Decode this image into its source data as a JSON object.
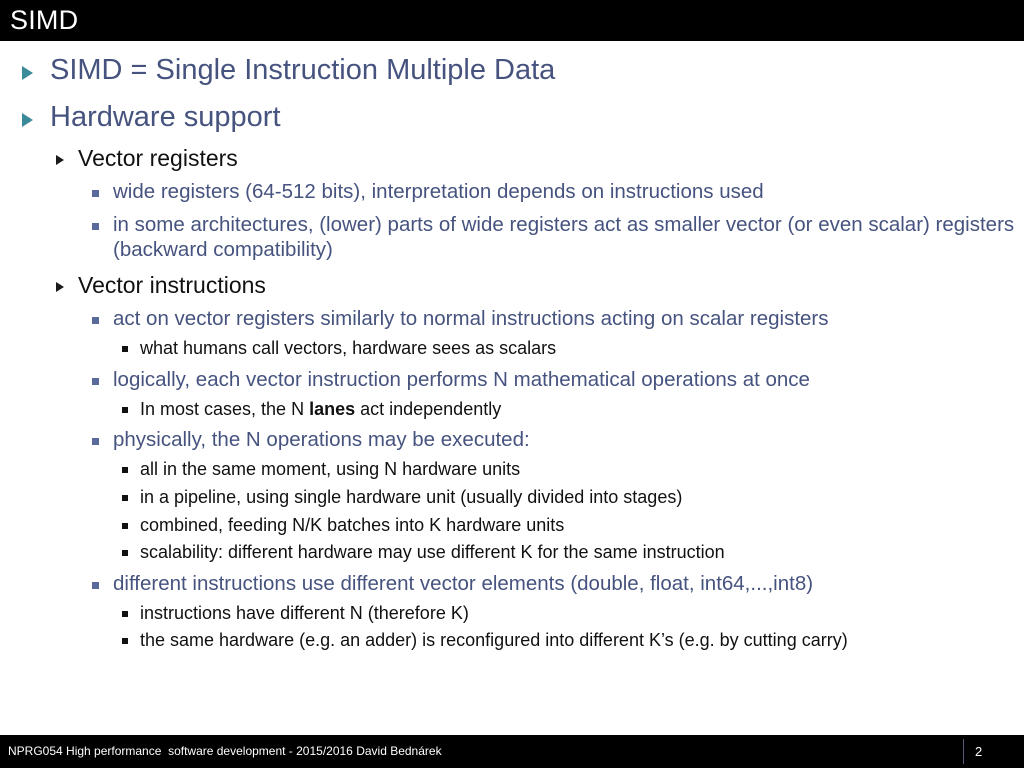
{
  "slide": {
    "title": "SIMD",
    "page_number": "2",
    "colors": {
      "title_bar_bg": "#000000",
      "title_text": "#ffffff",
      "slate_blue_text": "#46537f",
      "black_text": "#111111",
      "level1_marker": "#3b8a99",
      "level3_marker": "#5a6a9a",
      "footer_bg": "#000000",
      "footer_divider": "#5a5a78",
      "page_bg": "#ffffff"
    }
  },
  "bullets": [
    {
      "level": 1,
      "marker": "triangle-right-icon",
      "text": "SIMD = Single Instruction Multiple Data"
    },
    {
      "level": 1,
      "marker": "triangle-right-icon",
      "text": "Hardware support"
    },
    {
      "level": 2,
      "marker": "triangle-right-icon",
      "text": "Vector registers"
    },
    {
      "level": 3,
      "marker": "square-bullet-icon",
      "text": "wide registers (64-512 bits), interpretation depends on instructions used"
    },
    {
      "level": 3,
      "marker": "square-bullet-icon",
      "text": "in some architectures, (lower) parts of wide registers act as smaller vector (or even scalar) registers (backward compatibility)"
    },
    {
      "level": 2,
      "marker": "triangle-right-icon",
      "text": "Vector instructions"
    },
    {
      "level": 3,
      "marker": "square-bullet-icon",
      "text": "act on vector registers similarly to normal instructions acting on scalar registers"
    },
    {
      "level": 4,
      "marker": "square-bullet-icon",
      "text": "what humans call vectors, hardware sees as scalars"
    },
    {
      "level": 3,
      "marker": "square-bullet-icon",
      "text": "logically, each vector instruction performs N mathematical operations at once"
    },
    {
      "level": 4,
      "marker": "square-bullet-icon",
      "html": "In most cases, the N <b>lanes</b> act independently",
      "text": "In most cases, the N lanes act independently"
    },
    {
      "level": 3,
      "marker": "square-bullet-icon",
      "text": "physically, the N operations may be executed:"
    },
    {
      "level": 4,
      "marker": "square-bullet-icon",
      "text": "all in the same moment, using N hardware units"
    },
    {
      "level": 4,
      "marker": "square-bullet-icon",
      "text": "in a pipeline, using single hardware unit (usually divided into stages)"
    },
    {
      "level": 4,
      "marker": "square-bullet-icon",
      "text": "combined, feeding N/K batches into K hardware units"
    },
    {
      "level": 4,
      "marker": "square-bullet-icon",
      "text": "scalability: different hardware may use different K for the same instruction"
    },
    {
      "level": 3,
      "marker": "square-bullet-icon",
      "text": "different instructions use different vector elements (double, float, int64,...,int8)"
    },
    {
      "level": 4,
      "marker": "square-bullet-icon",
      "text": "instructions have different N (therefore K)"
    },
    {
      "level": 4,
      "marker": "square-bullet-icon",
      "text": "the same hardware (e.g. an adder) is reconfigured into different K’s (e.g. by cutting carry)"
    }
  ],
  "footer": {
    "course_line": "NPRG054 High performance  software development - 2015/2016 David Bednárek",
    "page_number": "2"
  }
}
